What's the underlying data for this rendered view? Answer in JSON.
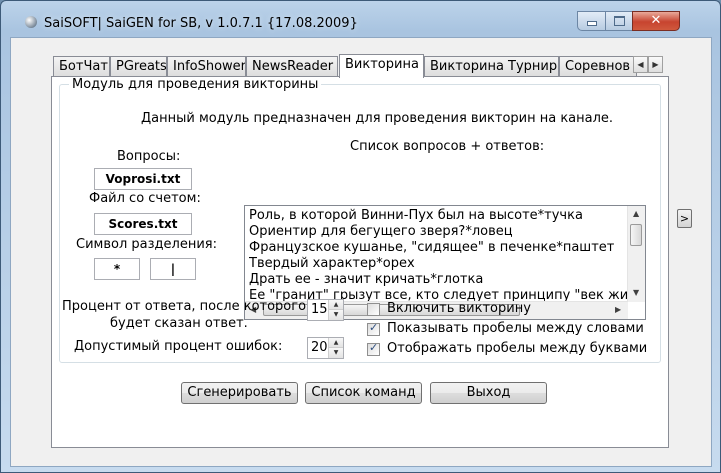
{
  "window": {
    "title": "SaiSOFT| SaiGEN for SB, v 1.0.7.1 {17.08.2009}",
    "min_glyph": "",
    "max_glyph": "",
    "close_glyph": "✕"
  },
  "tabs": [
    {
      "label": "БотЧат",
      "active": false
    },
    {
      "label": "PGreats",
      "active": false
    },
    {
      "label": "InfoShower",
      "active": false
    },
    {
      "label": "NewsReader",
      "active": false
    },
    {
      "label": "Викторина",
      "active": true
    },
    {
      "label": "Викторина Турнир",
      "active": false
    },
    {
      "label": "Соревнов",
      "active": false
    }
  ],
  "tab_scroll": {
    "left": "◀",
    "right": "▶"
  },
  "group": {
    "title": "Модуль для проведения викторины",
    "description": "Данный модуль предназначен для проведения викторин на канале."
  },
  "fields": {
    "questions_label": "Вопросы:",
    "questions_value": "Voprosi.txt",
    "scores_label": "Файл со счетом:",
    "scores_value": "Scores.txt",
    "separator_label": "Символ разделения:",
    "separator_1": "*",
    "separator_2": "|"
  },
  "list": {
    "label": "Список вопросов + ответов:",
    "items": [
      "Роль, в которой Винни-Пух был на высоте*тучка",
      "Ориентир для бегущего зверя?*ловец",
      "Французское кушанье, \"сидящее\" в печенке*паштет",
      "Твердый характер*орех",
      "Драть ее - значит кричать*глотка",
      "Ее \"гранит\" грызут все, кто следует принципу \"век живи -"
    ]
  },
  "percent": {
    "answer_label_1": "Процент от ответа, после которого",
    "answer_label_2": "будет сказан ответ.",
    "answer_value": "15",
    "errors_label": "Допустимый процент ошибок:",
    "errors_value": "20"
  },
  "options": [
    {
      "label": "Включить  викторину",
      "checked": false
    },
    {
      "label": "Показывать пробелы между словами",
      "checked": true
    },
    {
      "label": "Отображать пробелы между буквами",
      "checked": true
    }
  ],
  "buttons": {
    "generate": "Сгенерировать",
    "commands": "Список команд",
    "exit": "Выход"
  },
  "side_button": ">",
  "checkmark": "✓",
  "arrows": {
    "up": "▲",
    "down": "▼",
    "left": "◀",
    "right": "▶"
  }
}
